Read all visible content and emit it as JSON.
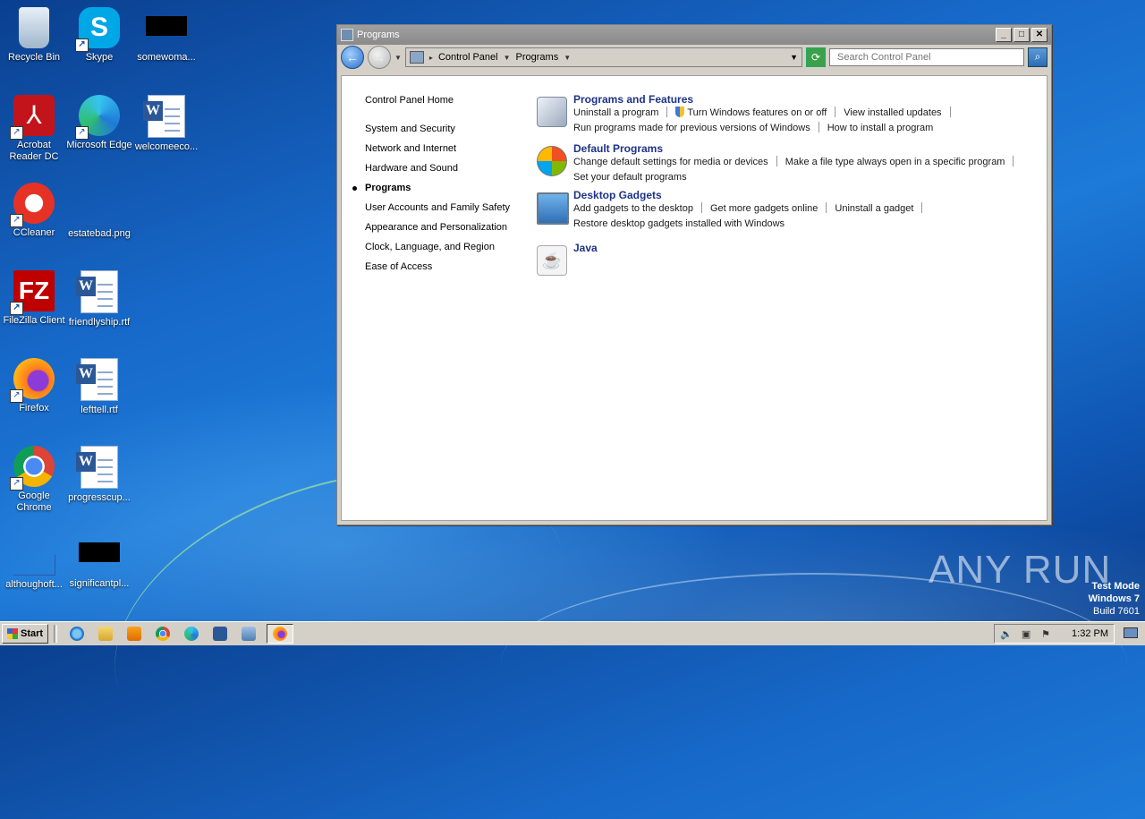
{
  "desktop": {
    "icons": [
      {
        "label": "Recycle Bin"
      },
      {
        "label": "Skype"
      },
      {
        "label": "somewoma..."
      },
      {
        "label": "Acrobat Reader DC"
      },
      {
        "label": "Microsoft Edge"
      },
      {
        "label": "welcomeeco..."
      },
      {
        "label": "CCleaner"
      },
      {
        "label": "estatebad.png"
      },
      {
        "label": "FileZilla Client"
      },
      {
        "label": "friendlyship.rtf"
      },
      {
        "label": "Firefox"
      },
      {
        "label": "lefttell.rtf"
      },
      {
        "label": "Google Chrome"
      },
      {
        "label": "progresscup..."
      },
      {
        "label": "althoughoft..."
      },
      {
        "label": "significantpl..."
      }
    ]
  },
  "window": {
    "title": "Programs",
    "breadcrumb": [
      "Control Panel",
      "Programs"
    ],
    "search_placeholder": "Search Control Panel",
    "left_nav": {
      "home": "Control Panel Home",
      "items": [
        {
          "label": "System and Security"
        },
        {
          "label": "Network and Internet"
        },
        {
          "label": "Hardware and Sound"
        },
        {
          "label": "Programs"
        },
        {
          "label": "User Accounts and Family Safety"
        },
        {
          "label": "Appearance and Personalization"
        },
        {
          "label": "Clock, Language, and Region"
        },
        {
          "label": "Ease of Access"
        }
      ]
    },
    "categories": [
      {
        "title": "Programs and Features",
        "line1": [
          "Uninstall a program",
          "Turn Windows features on or off",
          "View installed updates"
        ],
        "line2": [
          "Run programs made for previous versions of Windows",
          "How to install a program"
        ]
      },
      {
        "title": "Default Programs",
        "line1": [
          "Change default settings for media or devices",
          "Make a file type always open in a specific program"
        ],
        "line2": [
          "Set your default programs"
        ]
      },
      {
        "title": "Desktop Gadgets",
        "line1": [
          "Add gadgets to the desktop",
          "Get more gadgets online",
          "Uninstall a gadget"
        ],
        "line2": [
          "Restore desktop gadgets installed with Windows"
        ]
      },
      {
        "title": "Java"
      }
    ]
  },
  "watermark": {
    "text": "ANY RUN",
    "line1": "Test Mode",
    "line2": "Windows 7",
    "line3": "Build 7601"
  },
  "taskbar": {
    "start_label": "Start",
    "clock": "1:32 PM"
  }
}
